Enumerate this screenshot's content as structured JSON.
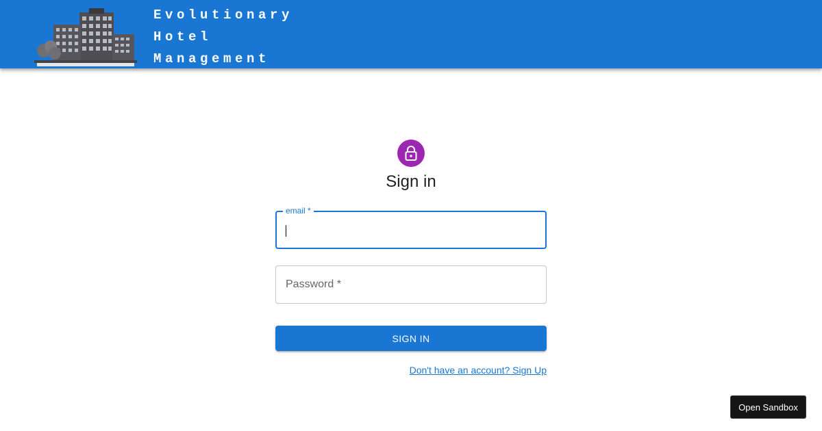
{
  "header": {
    "brand_lines": [
      "Evolutionary",
      "Hotel",
      "Management"
    ],
    "logo_caption": "Evolutionary Hotel Management",
    "color": "#1976d2"
  },
  "signin": {
    "avatar_icon": "lock-icon",
    "avatar_color": "#9c27b0",
    "title": "Sign in",
    "email_label": "email *",
    "email_value": "",
    "password_label": "Password *",
    "password_value": "",
    "submit_label": "Sign In",
    "signup_link": "Don't have an account? Sign Up"
  },
  "sandbox": {
    "button_label": "Open Sandbox"
  }
}
